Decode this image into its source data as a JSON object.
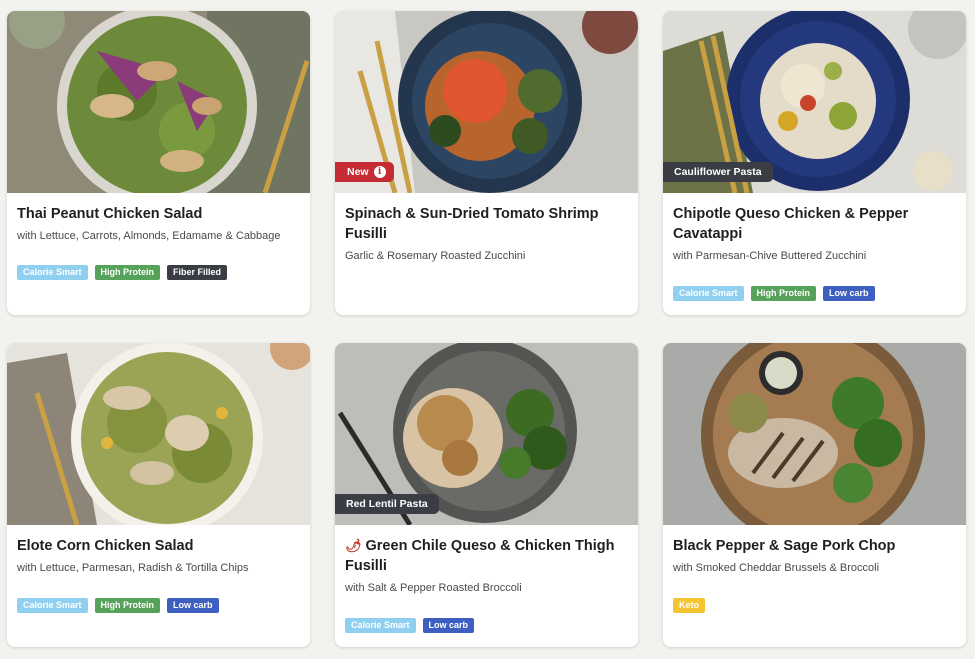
{
  "colors": {
    "calorie_smart": "#8fd0f0",
    "high_protein": "#56a25a",
    "fiber_filled": "#3a3d44",
    "low_carb": "#3d5fc0",
    "keto": "#f2c531",
    "new_tag": "#c32b35",
    "dark_tag": "#3a3d44"
  },
  "cards": [
    {
      "title": "Thai Peanut Chicken Salad",
      "subtitle": "with Lettuce, Carrots, Almonds, Edamame & Cabbage",
      "badges": [
        "Calorie Smart",
        "High Protein",
        "Fiber Filled"
      ]
    },
    {
      "tag": "New",
      "title": "Spinach & Sun-Dried Tomato Shrimp Fusilli",
      "subtitle": "Garlic & Rosemary Roasted Zucchini",
      "badges": []
    },
    {
      "tag": "Cauliflower Pasta",
      "title": "Chipotle Queso Chicken & Pepper Cavatappi",
      "subtitle": "with Parmesan-Chive Buttered Zucchini",
      "badges": [
        "Calorie Smart",
        "High Protein",
        "Low carb"
      ]
    },
    {
      "title": "Elote Corn Chicken Salad",
      "subtitle": "with Lettuce, Parmesan, Radish & Tortilla Chips",
      "badges": [
        "Calorie Smart",
        "High Protein",
        "Low carb"
      ]
    },
    {
      "tag": "Red Lentil Pasta",
      "title": "Green Chile Queso & Chicken Thigh Fusilli",
      "subtitle": "with Salt & Pepper Roasted Broccoli",
      "badges": [
        "Calorie Smart",
        "Low carb"
      ]
    },
    {
      "title": "Black Pepper & Sage Pork Chop",
      "subtitle": "with Smoked Cheddar Brussels & Broccoli",
      "badges": [
        "Keto"
      ]
    }
  ]
}
